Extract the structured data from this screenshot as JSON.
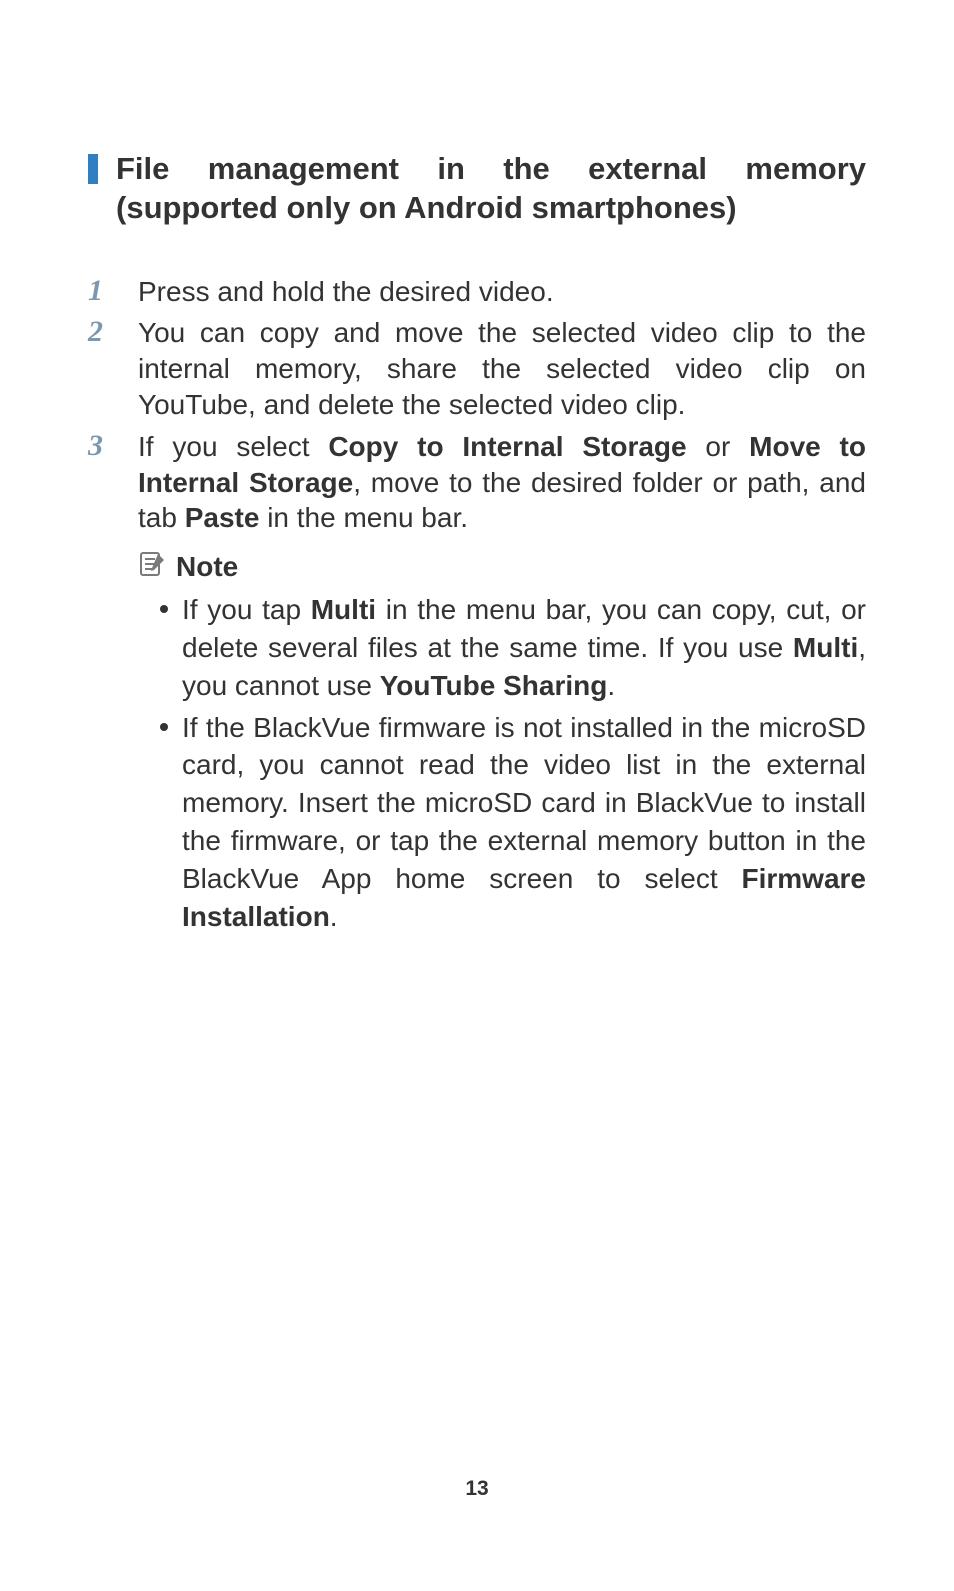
{
  "heading": "File management in the external memory (supported only on Android smartphones)",
  "steps": [
    {
      "num": "1",
      "segments": [
        {
          "t": "Press and hold the desired video."
        }
      ]
    },
    {
      "num": "2",
      "segments": [
        {
          "t": "You can copy and move the selected video clip to the internal memory, share the selected video clip on YouTube, and delete the selected video clip."
        }
      ]
    },
    {
      "num": "3",
      "segments": [
        {
          "t": "If you select "
        },
        {
          "t": "Copy to Internal Storage",
          "b": true
        },
        {
          "t": " or "
        },
        {
          "t": "Move to Internal Storage",
          "b": true
        },
        {
          "t": ", move to the desired folder or path, and tab "
        },
        {
          "t": "Paste",
          "b": true
        },
        {
          "t": " in the menu bar."
        }
      ]
    }
  ],
  "note": {
    "label": "Note",
    "bullets": [
      [
        {
          "t": "If you tap "
        },
        {
          "t": "Multi",
          "b": true
        },
        {
          "t": " in the menu bar, you can copy, cut, or delete several files at the same time. If you use "
        },
        {
          "t": "Multi",
          "b": true
        },
        {
          "t": ", you cannot use "
        },
        {
          "t": "YouTube Sharing",
          "b": true
        },
        {
          "t": "."
        }
      ],
      [
        {
          "t": "If the BlackVue firmware is not installed in the microSD card, you cannot read the video list in the external memory. Insert the microSD card in BlackVue to install the firmware, or tap the external memory button in the BlackVue App home screen to select "
        },
        {
          "t": "Firmware Installation",
          "b": true
        },
        {
          "t": "."
        }
      ]
    ]
  },
  "pageNumber": "13"
}
